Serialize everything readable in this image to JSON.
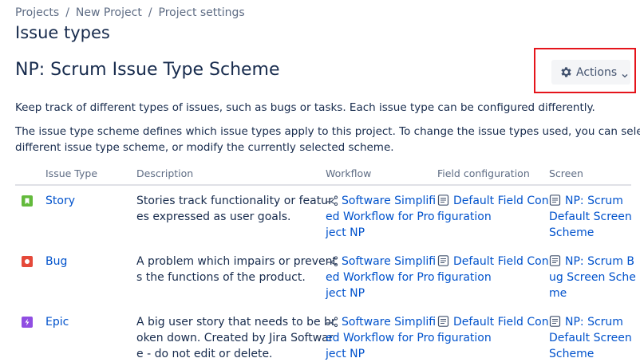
{
  "breadcrumb": {
    "items": [
      "Projects",
      "New Project",
      "Project settings"
    ],
    "separator": "/"
  },
  "page_title": "Issue types",
  "scheme_title": "NP: Scrum Issue Type Scheme",
  "actions_label": "Actions",
  "paragraph1": "Keep track of different types of issues, such as bugs or tasks. Each issue type can be configured differently.",
  "paragraph2_lines": [
    "The issue type scheme defines which issue types apply to this project. To change the issue types used, you can select a",
    "different issue type scheme, or modify the currently selected scheme."
  ],
  "table": {
    "headers": {
      "issue_type": "Issue Type",
      "description": "Description",
      "workflow": "Workflow",
      "field_configuration": "Field configuration",
      "screen": "Screen"
    },
    "rows": [
      {
        "name": "Story",
        "icon": "story-icon",
        "icon_color": "#63ba3c",
        "description_lines": [
          "Stories track functionality or featur",
          "es expressed as user goals."
        ],
        "workflow_lines": [
          "Software Simplifi",
          "ed Workflow for Pro",
          "ject NP"
        ],
        "field_config_lines": [
          "Default Field Con",
          "figuration"
        ],
        "screen_lines": [
          "NP: Scrum",
          "Default Screen",
          "Scheme"
        ]
      },
      {
        "name": "Bug",
        "icon": "bug-icon",
        "icon_color": "#e5493a",
        "description_lines": [
          "A problem which impairs or prevent",
          "s the functions of the product."
        ],
        "workflow_lines": [
          "Software Simplifi",
          "ed Workflow for Pro",
          "ject NP"
        ],
        "field_config_lines": [
          "Default Field Con",
          "figuration"
        ],
        "screen_lines": [
          "NP: Scrum B",
          "ug Screen Sche",
          "me"
        ]
      },
      {
        "name": "Epic",
        "icon": "epic-icon",
        "icon_color": "#904ee2",
        "description_lines": [
          "A big user story that needs to be br",
          "oken down. Created by Jira Softwar",
          "e - do not edit or delete."
        ],
        "workflow_lines": [
          "Software Simplifi",
          "ed Workflow for Pro",
          "ject NP"
        ],
        "field_config_lines": [
          "Default Field Con",
          "figuration"
        ],
        "screen_lines": [
          "NP: Scrum",
          "Default Screen",
          "Scheme"
        ]
      }
    ]
  },
  "colors": {
    "link": "#0052cc",
    "text": "#172b4d",
    "muted": "#5e6c84",
    "highlight": "#e5141b"
  }
}
